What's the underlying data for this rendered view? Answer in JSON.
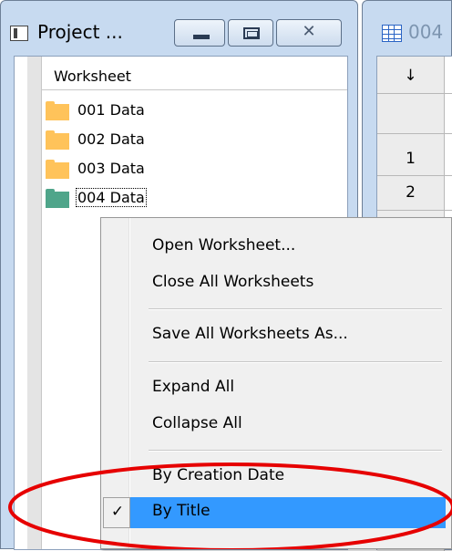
{
  "project_window": {
    "title": "Project ...",
    "controls": {
      "minimize": "minimize",
      "maximize": "maximize",
      "close": "✕"
    },
    "tree": {
      "header": "Worksheet",
      "items": [
        {
          "label": "001 Data",
          "icon": "folder-icon",
          "color": "#ffc35a"
        },
        {
          "label": "002 Data",
          "icon": "folder-icon",
          "color": "#ffc35a"
        },
        {
          "label": "003 Data",
          "icon": "folder-icon",
          "color": "#ffc35a"
        },
        {
          "label": "004 Data",
          "icon": "folder-icon",
          "color": "#4fa58a",
          "focused": true
        }
      ]
    }
  },
  "worksheet_window": {
    "title": "004",
    "icon": "table-icon",
    "grid": {
      "header_symbol": "↓",
      "rows": [
        "1",
        "2"
      ]
    }
  },
  "context_menu": {
    "items": [
      {
        "label": "Open Worksheet..."
      },
      {
        "label": "Close All Worksheets"
      },
      {
        "label": "Save All Worksheets As..."
      },
      {
        "label": "Expand All"
      },
      {
        "label": "Collapse All"
      },
      {
        "label": "By Creation Date"
      },
      {
        "label": "By Title",
        "checked": true,
        "selected": true,
        "check_mark": "✓"
      }
    ],
    "highlight_color": "#3399ff"
  },
  "annotation": {
    "color": "#e60000"
  }
}
